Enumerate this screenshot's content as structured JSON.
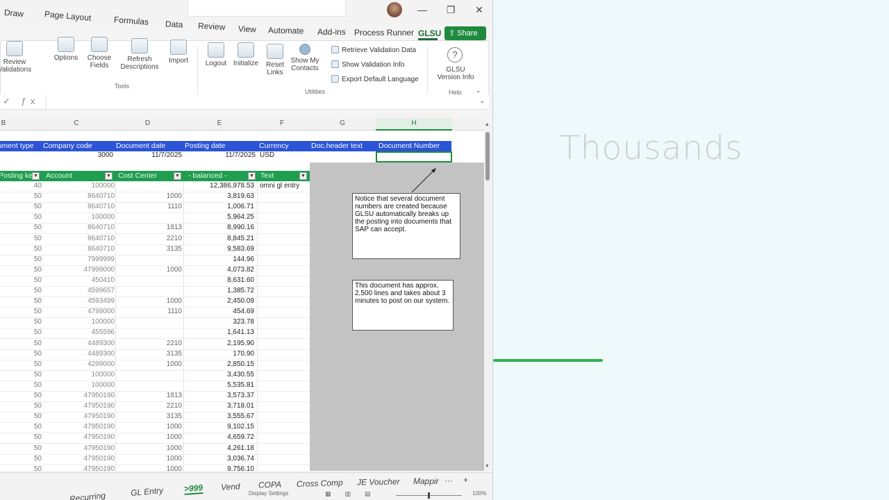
{
  "promo": {
    "word": "Thousands",
    "accent": "#2fb14f"
  },
  "window": {
    "controls": {
      "minimize": "—",
      "restore": "❐",
      "close": "✕"
    }
  },
  "ribbon_tabs": [
    {
      "label": "Draw"
    },
    {
      "label": "Page Layout"
    },
    {
      "label": "Formulas"
    },
    {
      "label": "Data"
    },
    {
      "label": "Review"
    },
    {
      "label": "View"
    },
    {
      "label": "Automate"
    },
    {
      "label": "Add-ins"
    },
    {
      "label": "Process Runner"
    },
    {
      "label": "GLSU"
    }
  ],
  "share_label": "Share",
  "ribbon": {
    "tools": [
      {
        "label": "Review Validations"
      },
      {
        "label": "Options"
      },
      {
        "label": "Choose Fields"
      },
      {
        "label": "Refresh Descriptions"
      },
      {
        "label": "Import"
      }
    ],
    "tools_group": "Tools",
    "utilities": [
      {
        "label": "Logout"
      },
      {
        "label": "Initialize"
      },
      {
        "label": "Reset Links"
      },
      {
        "label": "Show My Contacts"
      }
    ],
    "utility_rows": [
      "Retrieve Validation Data",
      "Show Validation Info",
      "Export Default Language"
    ],
    "utilities_group": "Utilities",
    "help": {
      "label": "GLSU Version Info",
      "group": "Help",
      "icon": "?"
    }
  },
  "columns": [
    "B",
    "C",
    "D",
    "E",
    "F",
    "G",
    "H"
  ],
  "header_row": {
    "labels": [
      "Document type",
      "Company code",
      "Document date",
      "Posting date",
      "Currency",
      "Doc.header text",
      "Document Number"
    ],
    "values": {
      "company_code": "3000",
      "doc_date": "11/7/2025",
      "posting_date": "11/7/2025",
      "currency": "USD"
    }
  },
  "line_header": [
    "Posting key",
    "Account",
    "Cost Center",
    "- balanced -",
    "Text"
  ],
  "lines": [
    {
      "pk": "40",
      "acct": "100000",
      "cc": "",
      "amt": "12,386,978.53",
      "txt": "omni gl entry"
    },
    {
      "pk": "50",
      "acct": "8640710",
      "cc": "1000",
      "amt": "3,819.63",
      "txt": ""
    },
    {
      "pk": "50",
      "acct": "8640710",
      "cc": "1110",
      "amt": "1,006.71",
      "txt": ""
    },
    {
      "pk": "50",
      "acct": "100000",
      "cc": "",
      "amt": "5,964.25",
      "txt": ""
    },
    {
      "pk": "50",
      "acct": "8640710",
      "cc": "1813",
      "amt": "8,990.16",
      "txt": ""
    },
    {
      "pk": "50",
      "acct": "8640710",
      "cc": "2210",
      "amt": "8,845.21",
      "txt": ""
    },
    {
      "pk": "50",
      "acct": "8640710",
      "cc": "3135",
      "amt": "9,583.69",
      "txt": ""
    },
    {
      "pk": "50",
      "acct": "7999999",
      "cc": "",
      "amt": "144.96",
      "txt": ""
    },
    {
      "pk": "50",
      "acct": "47999000",
      "cc": "1000",
      "amt": "4,073.82",
      "txt": ""
    },
    {
      "pk": "50",
      "acct": "450410",
      "cc": "",
      "amt": "8,631.60",
      "txt": ""
    },
    {
      "pk": "50",
      "acct": "4599657",
      "cc": "",
      "amt": "1,385.72",
      "txt": ""
    },
    {
      "pk": "50",
      "acct": "4593499",
      "cc": "1000",
      "amt": "2,450.09",
      "txt": ""
    },
    {
      "pk": "50",
      "acct": "4799000",
      "cc": "1110",
      "amt": "454.69",
      "txt": ""
    },
    {
      "pk": "50",
      "acct": "100000",
      "cc": "",
      "amt": "323.78",
      "txt": ""
    },
    {
      "pk": "50",
      "acct": "455596",
      "cc": "",
      "amt": "1,641.13",
      "txt": ""
    },
    {
      "pk": "50",
      "acct": "4489300",
      "cc": "2210",
      "amt": "2,195.90",
      "txt": ""
    },
    {
      "pk": "50",
      "acct": "4489300",
      "cc": "3135",
      "amt": "170.90",
      "txt": ""
    },
    {
      "pk": "50",
      "acct": "4299000",
      "cc": "1000",
      "amt": "2,850.15",
      "txt": ""
    },
    {
      "pk": "50",
      "acct": "100000",
      "cc": "",
      "amt": "3,430.55",
      "txt": ""
    },
    {
      "pk": "50",
      "acct": "100000",
      "cc": "",
      "amt": "5,535.81",
      "txt": ""
    },
    {
      "pk": "50",
      "acct": "47950190",
      "cc": "1813",
      "amt": "3,573.37",
      "txt": ""
    },
    {
      "pk": "50",
      "acct": "47950190",
      "cc": "2210",
      "amt": "3,718.01",
      "txt": ""
    },
    {
      "pk": "50",
      "acct": "47950190",
      "cc": "3135",
      "amt": "3,555.67",
      "txt": ""
    },
    {
      "pk": "50",
      "acct": "47950190",
      "cc": "1000",
      "amt": "9,102.15",
      "txt": ""
    },
    {
      "pk": "50",
      "acct": "47950190",
      "cc": "1000",
      "amt": "4,659.72",
      "txt": ""
    },
    {
      "pk": "50",
      "acct": "47950190",
      "cc": "1000",
      "amt": "4,261.18",
      "txt": ""
    },
    {
      "pk": "50",
      "acct": "47950190",
      "cc": "1000",
      "amt": "3,036.74",
      "txt": ""
    },
    {
      "pk": "50",
      "acct": "47950190",
      "cc": "1000",
      "amt": "9,756.10",
      "txt": ""
    }
  ],
  "notes": {
    "note1": "Notice that several document numbers are created because GLSU automatically breaks up the posting into documents that SAP can accept.",
    "note2": "This document has approx. 2,500 lines and takes about 3 minutes to post on our system."
  },
  "sheet_tabs": [
    {
      "label": "Recurring"
    },
    {
      "label": "GL Entry"
    },
    {
      "label": ">999",
      "active": true
    },
    {
      "label": "Vend"
    },
    {
      "label": "COPA"
    },
    {
      "label": "Cross Comp"
    },
    {
      "label": "JE Voucher"
    },
    {
      "label": "Mappir"
    }
  ],
  "sheet_more": "···",
  "sheet_add": "+",
  "status": {
    "settings": "Display Settings",
    "zoom": "100%"
  },
  "colors": {
    "blue_header": "#2b54d6",
    "green_header": "#1f9e4f",
    "glsu_green": "#1f8b3e"
  }
}
